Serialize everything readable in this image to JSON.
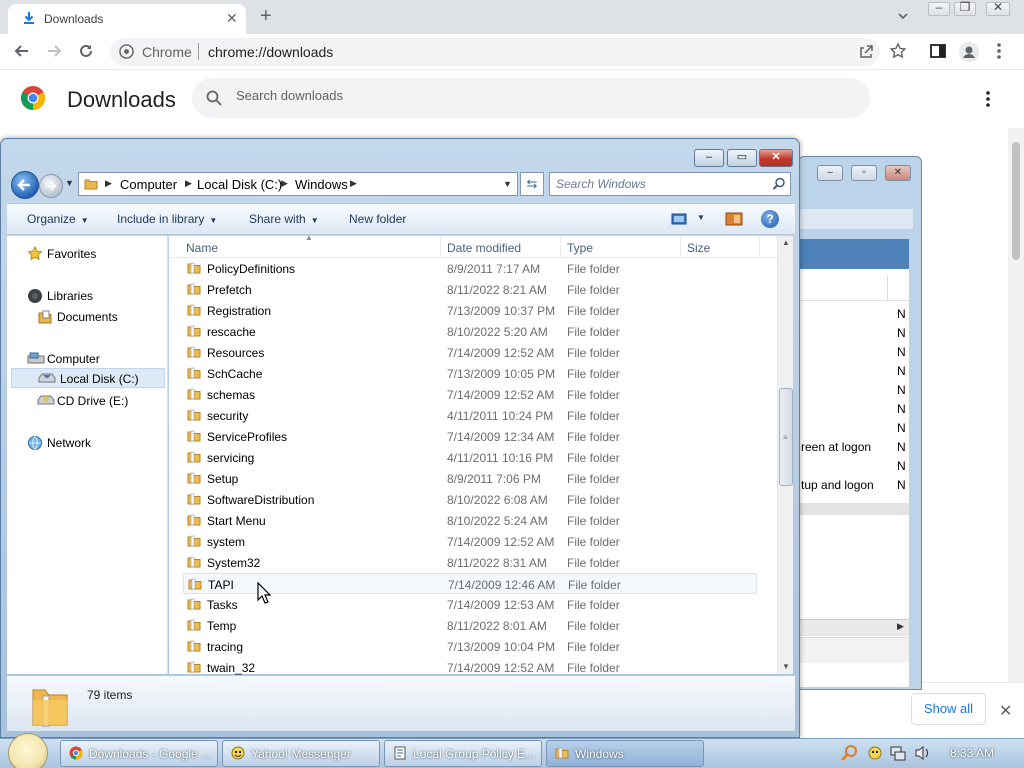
{
  "chrome": {
    "tab_title": "Downloads",
    "omnibox_site": "Chrome",
    "omnibox_url": "chrome://downloads"
  },
  "downloads_page": {
    "title": "Downloads",
    "search_placeholder": "Search downloads",
    "show_all_label": "Show all"
  },
  "explorer": {
    "breadcrumbs": [
      "Computer",
      "Local Disk (C:)",
      "Windows"
    ],
    "search_placeholder": "Search Windows",
    "commands": [
      "Organize",
      "Include in library",
      "Share with",
      "New folder"
    ],
    "nav": {
      "favorites": "Favorites",
      "libraries": "Libraries",
      "documents": "Documents",
      "computer": "Computer",
      "local_disk": "Local Disk (C:)",
      "cd_drive": "CD Drive (E:)",
      "network": "Network"
    },
    "columns": [
      "Name",
      "Date modified",
      "Type",
      "Size"
    ],
    "files": [
      {
        "name": "PolicyDefinitions",
        "date": "8/9/2011 7:17 AM",
        "type": "File folder"
      },
      {
        "name": "Prefetch",
        "date": "8/11/2022 8:21 AM",
        "type": "File folder"
      },
      {
        "name": "Registration",
        "date": "7/13/2009 10:37 PM",
        "type": "File folder"
      },
      {
        "name": "rescache",
        "date": "8/10/2022 5:20 AM",
        "type": "File folder"
      },
      {
        "name": "Resources",
        "date": "7/14/2009 12:52 AM",
        "type": "File folder"
      },
      {
        "name": "SchCache",
        "date": "7/13/2009 10:05 PM",
        "type": "File folder"
      },
      {
        "name": "schemas",
        "date": "7/14/2009 12:52 AM",
        "type": "File folder"
      },
      {
        "name": "security",
        "date": "4/11/2011 10:24 PM",
        "type": "File folder"
      },
      {
        "name": "ServiceProfiles",
        "date": "7/14/2009 12:34 AM",
        "type": "File folder"
      },
      {
        "name": "servicing",
        "date": "4/11/2011 10:16 PM",
        "type": "File folder"
      },
      {
        "name": "Setup",
        "date": "8/9/2011 7:06 PM",
        "type": "File folder"
      },
      {
        "name": "SoftwareDistribution",
        "date": "8/10/2022 6:08 AM",
        "type": "File folder"
      },
      {
        "name": "Start Menu",
        "date": "8/10/2022 5:24 AM",
        "type": "File folder"
      },
      {
        "name": "system",
        "date": "7/14/2009 12:52 AM",
        "type": "File folder"
      },
      {
        "name": "System32",
        "date": "8/11/2022 8:31 AM",
        "type": "File folder"
      },
      {
        "name": "TAPI",
        "date": "7/14/2009 12:46 AM",
        "type": "File folder"
      },
      {
        "name": "Tasks",
        "date": "7/14/2009 12:53 AM",
        "type": "File folder"
      },
      {
        "name": "Temp",
        "date": "8/11/2022 8:01 AM",
        "type": "File folder"
      },
      {
        "name": "tracing",
        "date": "7/13/2009 10:04 PM",
        "type": "File folder"
      },
      {
        "name": "twain_32",
        "date": "7/14/2009 12:52 AM",
        "type": "File folder"
      }
    ],
    "item_count": "79 items"
  },
  "background_window": {
    "rows": [
      {
        "text": "",
        "n": "N"
      },
      {
        "text": "",
        "n": "N"
      },
      {
        "text": "",
        "n": "N"
      },
      {
        "text": "",
        "n": "N"
      },
      {
        "text": "",
        "n": "N"
      },
      {
        "text": "",
        "n": "N"
      },
      {
        "text": "",
        "n": "N"
      },
      {
        "text": "reen at logon",
        "n": "N"
      },
      {
        "text": "",
        "n": "N"
      },
      {
        "text": "tup and logon",
        "n": "N"
      }
    ]
  },
  "taskbar": {
    "tasks": [
      {
        "label": "Downloads - Google ...",
        "icon": "chrome-icon"
      },
      {
        "label": "Yahoo! Messenger",
        "icon": "yahoo-messenger-icon"
      },
      {
        "label": "Local Group Policy E...",
        "icon": "group-policy-icon"
      },
      {
        "label": "Windows",
        "icon": "folder-icon"
      }
    ],
    "clock": "8:33 AM"
  }
}
